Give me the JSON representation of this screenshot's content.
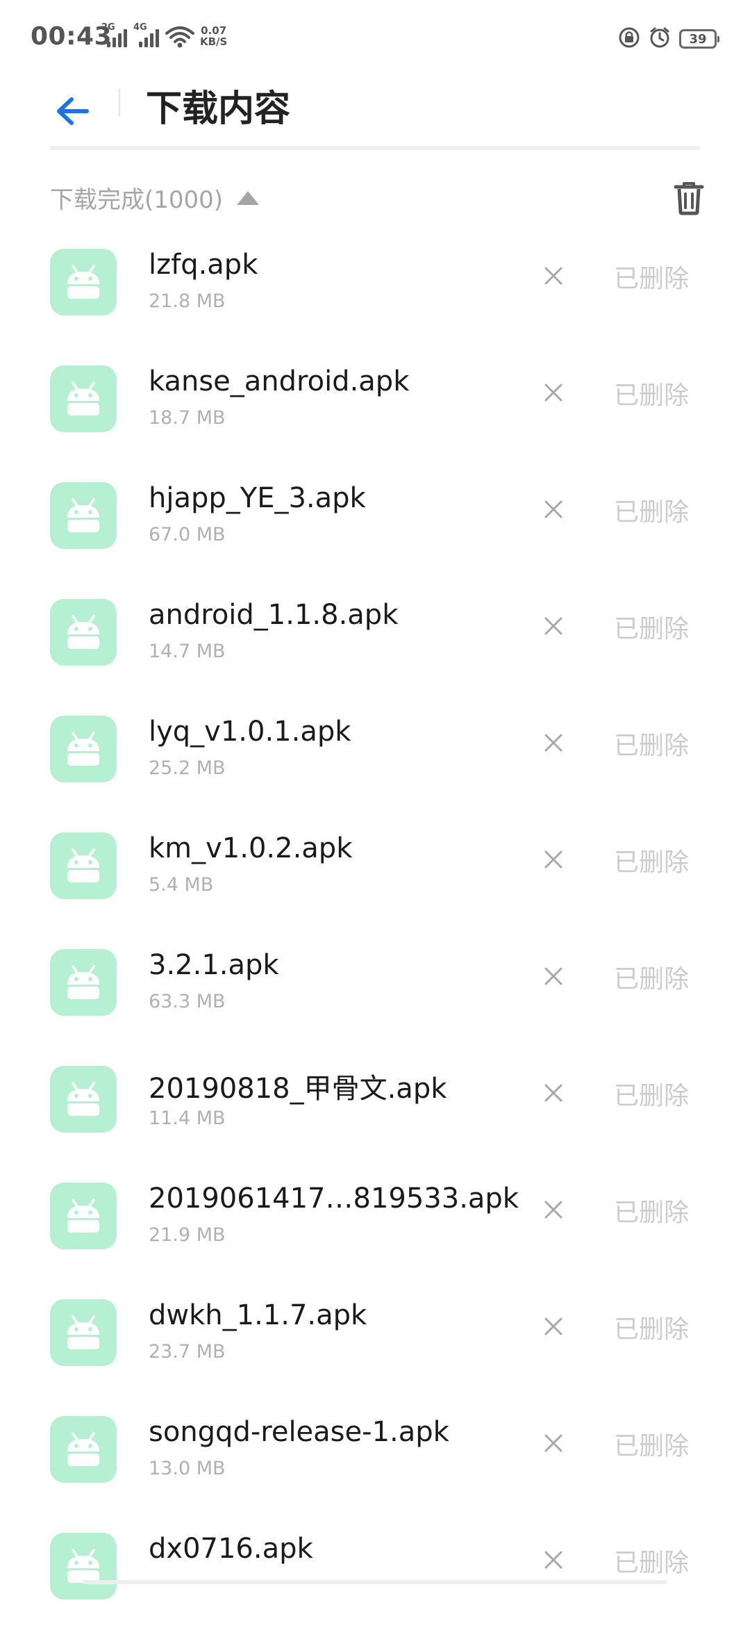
{
  "status_bar": {
    "time": "00:43",
    "net1": "2G",
    "net2": "4G",
    "speed_value": "0.07",
    "speed_unit": "KB/S",
    "battery": "39"
  },
  "header": {
    "title": "下载内容"
  },
  "section": {
    "title": "下载完成(1000)"
  },
  "downloads": [
    {
      "name": "lzfq.apk",
      "size": "21.8 MB",
      "status": "已删除"
    },
    {
      "name": "kanse_android.apk",
      "size": "18.7 MB",
      "status": "已删除"
    },
    {
      "name": "hjapp_YE_3.apk",
      "size": "67.0 MB",
      "status": "已删除"
    },
    {
      "name": "android_1.1.8.apk",
      "size": "14.7 MB",
      "status": "已删除"
    },
    {
      "name": "lyq_v1.0.1.apk",
      "size": "25.2 MB",
      "status": "已删除"
    },
    {
      "name": "km_v1.0.2.apk",
      "size": "5.4 MB",
      "status": "已删除"
    },
    {
      "name": "3.2.1.apk",
      "size": "63.3 MB",
      "status": "已删除"
    },
    {
      "name": "20190818_甲骨文.apk",
      "size": "11.4 MB",
      "status": "已删除"
    },
    {
      "name": "2019061417…819533.apk",
      "size": "21.9 MB",
      "status": "已删除"
    },
    {
      "name": "dwkh_1.1.7.apk",
      "size": "23.7 MB",
      "status": "已删除"
    },
    {
      "name": "songqd-release-1.apk",
      "size": "13.0 MB",
      "status": "已删除"
    },
    {
      "name": "dx0716.apk",
      "size": "",
      "status": "已删除"
    }
  ],
  "colors": {
    "accent": "#1a73e8",
    "app_icon_bg": "#b6f0d2",
    "app_icon_fg": "#ffffff"
  }
}
